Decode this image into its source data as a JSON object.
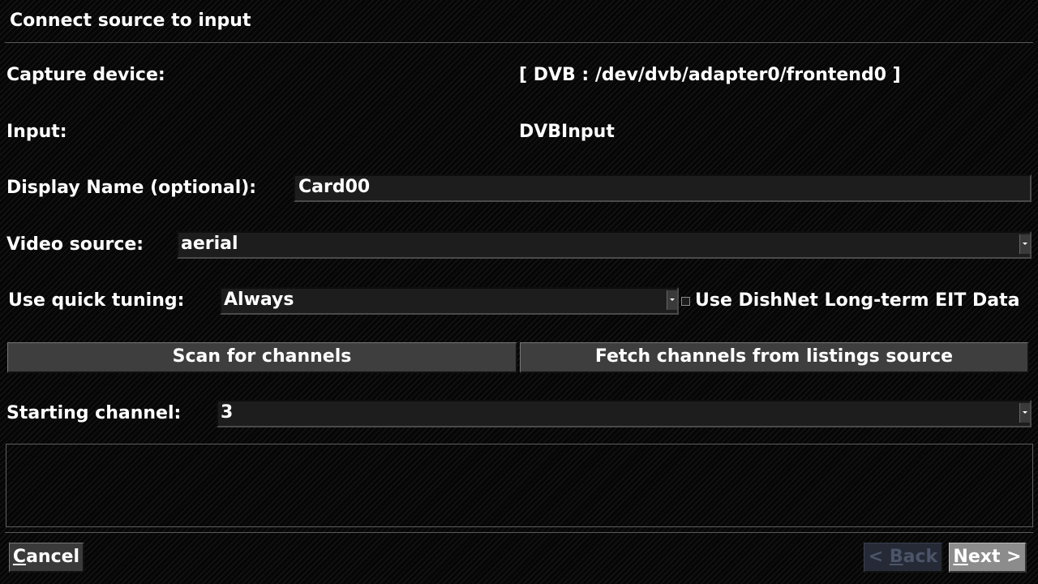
{
  "window": {
    "title": "Connect source to input"
  },
  "form": {
    "capture_device": {
      "label": "Capture device:",
      "value": "[ DVB : /dev/dvb/adapter0/frontend0 ]"
    },
    "input": {
      "label": "Input:",
      "value": "DVBInput"
    },
    "display_name": {
      "label": "Display Name (optional):",
      "value": "Card00"
    },
    "video_source": {
      "label": "Video source:",
      "selected": "aerial"
    },
    "quick_tuning": {
      "label": "Use quick tuning:",
      "selected": "Always"
    },
    "dishnet_eit": {
      "label": "Use DishNet Long-term EIT Data",
      "checked": false
    },
    "scan_button": "Scan for channels",
    "fetch_button": "Fetch channels from listings source",
    "starting_channel": {
      "label": "Starting channel:",
      "selected": "3"
    }
  },
  "footer": {
    "cancel": {
      "first": "C",
      "rest": "ancel"
    },
    "back": {
      "prefix": "< ",
      "first": "B",
      "rest": "ack"
    },
    "next": {
      "first": "N",
      "rest": "ext >"
    }
  }
}
